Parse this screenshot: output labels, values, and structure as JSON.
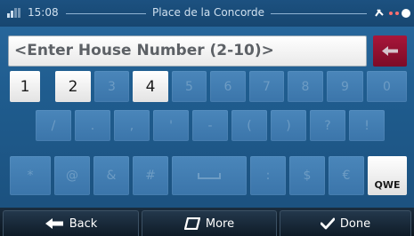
{
  "status_bar": {
    "time": "15:08",
    "location": "Place de la Concorde",
    "signal_icon": "signal-bars-icon",
    "gps_icon": "gps-satellite-icon"
  },
  "input": {
    "placeholder": "<Enter House Number (2-10)>",
    "value": ""
  },
  "backspace_icon": "backspace-arrow-icon",
  "keyboard": {
    "row1": [
      "1",
      "2",
      "3",
      "4",
      "5",
      "6",
      "7",
      "8",
      "9",
      "0"
    ],
    "row1_enabled": [
      true,
      true,
      false,
      true,
      false,
      false,
      false,
      false,
      false,
      false
    ],
    "row2": [
      "/",
      ".",
      ",",
      "'",
      "-",
      "(",
      ")",
      "?",
      "!"
    ],
    "row3_left": [
      "*",
      "@",
      "&",
      "#"
    ],
    "row3_right": [
      ":",
      "$",
      "€"
    ],
    "space_icon": "space-bar-icon",
    "layout_switch": "QWE"
  },
  "bottom": {
    "back_label": "Back",
    "more_label": "More",
    "done_label": "Done"
  },
  "colors": {
    "background": "#1f5c8e",
    "key_disabled": "#3f7aae",
    "key_enabled": "#ffffff",
    "backspace": "#8e0f2e",
    "bottom_bar": "#122230"
  }
}
